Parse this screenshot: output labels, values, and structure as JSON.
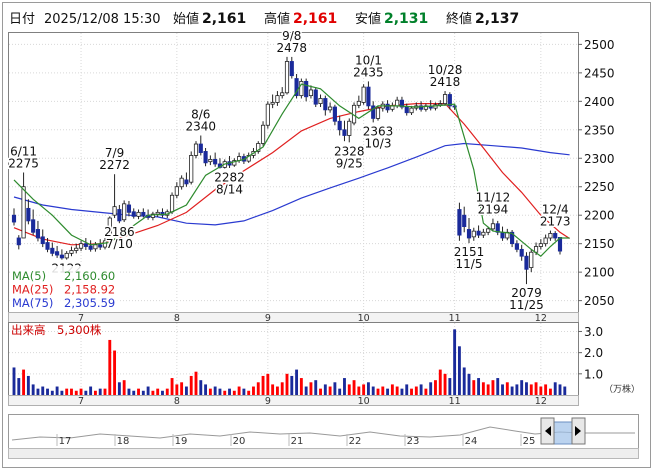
{
  "header": {
    "date_label": "日付",
    "datetime": "2025/12/08 15:30",
    "open_label": "始値",
    "open": "2,161",
    "high_label": "高値",
    "high": "2,161",
    "low_label": "安値",
    "low": "2,131",
    "close_label": "終値",
    "close": "2,137"
  },
  "colors": {
    "up": "#ff0000",
    "down": "#1a2a9a",
    "ma5": "#2e8b2e",
    "ma25": "#e02020",
    "ma75": "#2a3ad0",
    "volume_up": "#ff0000",
    "volume_down": "#1a2a9a",
    "volume_label": "#cc0000"
  },
  "legend": [
    {
      "label": "MA(5)",
      "value": "2,160.60",
      "color": "#2e8b2e"
    },
    {
      "label": "MA(25)",
      "value": "2,158.92",
      "color": "#e02020"
    },
    {
      "label": "MA(75)",
      "value": "2,305.59",
      "color": "#2a3ad0"
    }
  ],
  "volume_header": {
    "label": "出来高",
    "value": "5,300株"
  },
  "volume_unit": "（万株）",
  "navigator": {
    "labels": [
      "17",
      "18",
      "19",
      "20",
      "21",
      "22",
      "23",
      "24",
      "25"
    ],
    "prev_icon": "arrow-left-icon",
    "next_icon": "arrow-right-icon"
  },
  "chart_data": {
    "type": "candlestick",
    "y_range": [
      2030,
      2520
    ],
    "y_ticks": [
      2050,
      2100,
      2150,
      2200,
      2250,
      2300,
      2350,
      2400,
      2450,
      2500
    ],
    "volume_range": [
      0,
      3.4
    ],
    "volume_ticks": [
      "1.0",
      "2.0",
      "3.0"
    ],
    "month_labels": [
      {
        "label": "7",
        "day": 14
      },
      {
        "label": "8",
        "day": 34
      },
      {
        "label": "9",
        "day": 53
      },
      {
        "label": "10",
        "day": 73
      },
      {
        "label": "11",
        "day": 92
      },
      {
        "label": "12",
        "day": 110
      }
    ],
    "annotations": [
      {
        "lines": [
          "6/11",
          "2275"
        ],
        "day": 2,
        "value": 2275,
        "position": "above"
      },
      {
        "lines": [
          "7/9",
          "2272"
        ],
        "day": 21,
        "value": 2272,
        "position": "above"
      },
      {
        "lines": [
          "2186",
          "7/10"
        ],
        "day": 22,
        "value": 2186,
        "position": "below"
      },
      {
        "lines": [
          "2122"
        ],
        "day": 11,
        "value": 2122,
        "position": "below"
      },
      {
        "lines": [
          "8/6",
          "2340"
        ],
        "day": 39,
        "value": 2340,
        "position": "above"
      },
      {
        "lines": [
          "2282",
          "8/14"
        ],
        "day": 45,
        "value": 2282,
        "position": "below"
      },
      {
        "lines": [
          "9/8",
          "2478"
        ],
        "day": 58,
        "value": 2478,
        "position": "above"
      },
      {
        "lines": [
          "2328",
          "9/25"
        ],
        "day": 70,
        "value": 2328,
        "position": "below"
      },
      {
        "lines": [
          "10/1",
          "2435"
        ],
        "day": 74,
        "value": 2435,
        "position": "above"
      },
      {
        "lines": [
          "2363",
          "10/3"
        ],
        "day": 76,
        "value": 2363,
        "position": "below"
      },
      {
        "lines": [
          "10/28",
          "2418"
        ],
        "day": 90,
        "value": 2418,
        "position": "above"
      },
      {
        "lines": [
          "2151",
          "11/5"
        ],
        "day": 95,
        "value": 2151,
        "position": "below"
      },
      {
        "lines": [
          "11/12",
          "2194"
        ],
        "day": 100,
        "value": 2194,
        "position": "above"
      },
      {
        "lines": [
          "2079",
          "11/25"
        ],
        "day": 107,
        "value": 2079,
        "position": "below"
      },
      {
        "lines": [
          "12/4",
          "2173"
        ],
        "day": 113,
        "value": 2173,
        "position": "above"
      }
    ],
    "candles": [
      {
        "o": 2200,
        "h": 2212,
        "c": 2188,
        "l": 2182
      },
      {
        "o": 2160,
        "h": 2165,
        "c": 2148,
        "l": 2140
      },
      {
        "o": 2160,
        "h": 2275,
        "c": 2250,
        "l": 2160
      },
      {
        "o": 2212,
        "h": 2228,
        "c": 2190,
        "l": 2184
      },
      {
        "o": 2192,
        "h": 2210,
        "c": 2170,
        "l": 2165
      },
      {
        "o": 2175,
        "h": 2190,
        "c": 2160,
        "l": 2154
      },
      {
        "o": 2162,
        "h": 2175,
        "c": 2150,
        "l": 2144
      },
      {
        "o": 2152,
        "h": 2160,
        "c": 2140,
        "l": 2135
      },
      {
        "o": 2142,
        "h": 2152,
        "c": 2133,
        "l": 2128
      },
      {
        "o": 2136,
        "h": 2146,
        "c": 2130,
        "l": 2125
      },
      {
        "o": 2130,
        "h": 2140,
        "c": 2125,
        "l": 2122
      },
      {
        "o": 2125,
        "h": 2137,
        "c": 2133,
        "l": 2122
      },
      {
        "o": 2133,
        "h": 2145,
        "c": 2138,
        "l": 2128
      },
      {
        "o": 2138,
        "h": 2150,
        "c": 2142,
        "l": 2133
      },
      {
        "o": 2142,
        "h": 2155,
        "c": 2150,
        "l": 2137
      },
      {
        "o": 2150,
        "h": 2160,
        "c": 2145,
        "l": 2139
      },
      {
        "o": 2146,
        "h": 2156,
        "c": 2140,
        "l": 2136
      },
      {
        "o": 2141,
        "h": 2153,
        "c": 2148,
        "l": 2136
      },
      {
        "o": 2148,
        "h": 2158,
        "c": 2144,
        "l": 2139
      },
      {
        "o": 2144,
        "h": 2160,
        "c": 2155,
        "l": 2140
      },
      {
        "o": 2155,
        "h": 2198,
        "c": 2195,
        "l": 2150
      },
      {
        "o": 2200,
        "h": 2272,
        "c": 2215,
        "l": 2195
      },
      {
        "o": 2210,
        "h": 2218,
        "c": 2190,
        "l": 2186
      },
      {
        "o": 2192,
        "h": 2226,
        "c": 2220,
        "l": 2188
      },
      {
        "o": 2218,
        "h": 2225,
        "c": 2205,
        "l": 2198
      },
      {
        "o": 2206,
        "h": 2212,
        "c": 2198,
        "l": 2194
      },
      {
        "o": 2198,
        "h": 2210,
        "c": 2205,
        "l": 2193
      },
      {
        "o": 2205,
        "h": 2212,
        "c": 2200,
        "l": 2196
      },
      {
        "o": 2200,
        "h": 2210,
        "c": 2196,
        "l": 2192
      },
      {
        "o": 2196,
        "h": 2206,
        "c": 2202,
        "l": 2191
      },
      {
        "o": 2202,
        "h": 2210,
        "c": 2205,
        "l": 2197
      },
      {
        "o": 2205,
        "h": 2212,
        "c": 2200,
        "l": 2196
      },
      {
        "o": 2200,
        "h": 2210,
        "c": 2206,
        "l": 2195
      },
      {
        "o": 2206,
        "h": 2240,
        "c": 2235,
        "l": 2202
      },
      {
        "o": 2235,
        "h": 2258,
        "c": 2250,
        "l": 2230
      },
      {
        "o": 2250,
        "h": 2270,
        "c": 2265,
        "l": 2245
      },
      {
        "o": 2262,
        "h": 2275,
        "c": 2255,
        "l": 2250
      },
      {
        "o": 2258,
        "h": 2312,
        "c": 2305,
        "l": 2254
      },
      {
        "o": 2305,
        "h": 2330,
        "c": 2325,
        "l": 2300
      },
      {
        "o": 2325,
        "h": 2340,
        "c": 2310,
        "l": 2305
      },
      {
        "o": 2312,
        "h": 2318,
        "c": 2292,
        "l": 2286
      },
      {
        "o": 2294,
        "h": 2305,
        "c": 2298,
        "l": 2288
      },
      {
        "o": 2298,
        "h": 2310,
        "c": 2290,
        "l": 2285
      },
      {
        "o": 2290,
        "h": 2300,
        "c": 2284,
        "l": 2282
      },
      {
        "o": 2284,
        "h": 2298,
        "c": 2294,
        "l": 2282
      },
      {
        "o": 2294,
        "h": 2304,
        "c": 2288,
        "l": 2283
      },
      {
        "o": 2288,
        "h": 2300,
        "c": 2296,
        "l": 2285
      },
      {
        "o": 2296,
        "h": 2310,
        "c": 2303,
        "l": 2292
      },
      {
        "o": 2303,
        "h": 2308,
        "c": 2295,
        "l": 2290
      },
      {
        "o": 2295,
        "h": 2310,
        "c": 2305,
        "l": 2292
      },
      {
        "o": 2305,
        "h": 2318,
        "c": 2312,
        "l": 2300
      },
      {
        "o": 2312,
        "h": 2330,
        "c": 2326,
        "l": 2308
      },
      {
        "o": 2326,
        "h": 2365,
        "c": 2358,
        "l": 2322
      },
      {
        "o": 2358,
        "h": 2400,
        "c": 2395,
        "l": 2352
      },
      {
        "o": 2395,
        "h": 2412,
        "c": 2398,
        "l": 2388
      },
      {
        "o": 2398,
        "h": 2418,
        "c": 2410,
        "l": 2392
      },
      {
        "o": 2410,
        "h": 2425,
        "c": 2415,
        "l": 2405
      },
      {
        "o": 2415,
        "h": 2478,
        "c": 2470,
        "l": 2412
      },
      {
        "o": 2470,
        "h": 2478,
        "c": 2445,
        "l": 2440
      },
      {
        "o": 2440,
        "h": 2448,
        "c": 2410,
        "l": 2405
      },
      {
        "o": 2410,
        "h": 2440,
        "c": 2435,
        "l": 2405
      },
      {
        "o": 2435,
        "h": 2440,
        "c": 2408,
        "l": 2400
      },
      {
        "o": 2410,
        "h": 2428,
        "c": 2420,
        "l": 2405
      },
      {
        "o": 2420,
        "h": 2425,
        "c": 2395,
        "l": 2390
      },
      {
        "o": 2396,
        "h": 2412,
        "c": 2405,
        "l": 2390
      },
      {
        "o": 2405,
        "h": 2410,
        "c": 2385,
        "l": 2375
      },
      {
        "o": 2385,
        "h": 2398,
        "c": 2390,
        "l": 2380
      },
      {
        "o": 2390,
        "h": 2394,
        "c": 2365,
        "l": 2358
      },
      {
        "o": 2365,
        "h": 2375,
        "c": 2350,
        "l": 2340
      },
      {
        "o": 2350,
        "h": 2366,
        "c": 2340,
        "l": 2330
      },
      {
        "o": 2340,
        "h": 2370,
        "c": 2365,
        "l": 2328
      },
      {
        "o": 2362,
        "h": 2398,
        "c": 2393,
        "l": 2358
      },
      {
        "o": 2393,
        "h": 2410,
        "c": 2400,
        "l": 2388
      },
      {
        "o": 2398,
        "h": 2430,
        "c": 2425,
        "l": 2394
      },
      {
        "o": 2425,
        "h": 2435,
        "c": 2392,
        "l": 2386
      },
      {
        "o": 2392,
        "h": 2400,
        "c": 2370,
        "l": 2363
      },
      {
        "o": 2370,
        "h": 2392,
        "c": 2388,
        "l": 2366
      },
      {
        "o": 2388,
        "h": 2400,
        "c": 2395,
        "l": 2382
      },
      {
        "o": 2395,
        "h": 2402,
        "c": 2385,
        "l": 2380
      },
      {
        "o": 2386,
        "h": 2398,
        "c": 2392,
        "l": 2382
      },
      {
        "o": 2392,
        "h": 2408,
        "c": 2402,
        "l": 2388
      },
      {
        "o": 2402,
        "h": 2408,
        "c": 2390,
        "l": 2386
      },
      {
        "o": 2390,
        "h": 2396,
        "c": 2380,
        "l": 2375
      },
      {
        "o": 2380,
        "h": 2392,
        "c": 2388,
        "l": 2376
      },
      {
        "o": 2388,
        "h": 2398,
        "c": 2392,
        "l": 2384
      },
      {
        "o": 2392,
        "h": 2400,
        "c": 2386,
        "l": 2382
      },
      {
        "o": 2386,
        "h": 2396,
        "c": 2392,
        "l": 2382
      },
      {
        "o": 2392,
        "h": 2402,
        "c": 2388,
        "l": 2384
      },
      {
        "o": 2388,
        "h": 2398,
        "c": 2394,
        "l": 2384
      },
      {
        "o": 2394,
        "h": 2402,
        "c": 2396,
        "l": 2390
      },
      {
        "o": 2396,
        "h": 2418,
        "c": 2412,
        "l": 2392
      },
      {
        "o": 2412,
        "h": 2416,
        "c": 2392,
        "l": 2386
      },
      {
        "o": 2392,
        "h": 2396,
        "c": 2390,
        "l": 2385
      },
      {
        "o": 2210,
        "h": 2222,
        "c": 2165,
        "l": 2155
      },
      {
        "o": 2200,
        "h": 2215,
        "c": 2180,
        "l": 2170
      },
      {
        "o": 2175,
        "h": 2195,
        "c": 2160,
        "l": 2151
      },
      {
        "o": 2162,
        "h": 2178,
        "c": 2172,
        "l": 2155
      },
      {
        "o": 2172,
        "h": 2182,
        "c": 2165,
        "l": 2160
      },
      {
        "o": 2165,
        "h": 2176,
        "c": 2170,
        "l": 2160
      },
      {
        "o": 2170,
        "h": 2180,
        "c": 2176,
        "l": 2165
      },
      {
        "o": 2176,
        "h": 2194,
        "c": 2185,
        "l": 2172
      },
      {
        "o": 2185,
        "h": 2190,
        "c": 2170,
        "l": 2165
      },
      {
        "o": 2170,
        "h": 2180,
        "c": 2160,
        "l": 2155
      },
      {
        "o": 2160,
        "h": 2176,
        "c": 2170,
        "l": 2156
      },
      {
        "o": 2170,
        "h": 2174,
        "c": 2150,
        "l": 2144
      },
      {
        "o": 2150,
        "h": 2156,
        "c": 2140,
        "l": 2135
      },
      {
        "o": 2140,
        "h": 2148,
        "c": 2128,
        "l": 2120
      },
      {
        "o": 2128,
        "h": 2135,
        "c": 2105,
        "l": 2079
      },
      {
        "o": 2108,
        "h": 2140,
        "c": 2135,
        "l": 2100
      },
      {
        "o": 2135,
        "h": 2152,
        "c": 2145,
        "l": 2130
      },
      {
        "o": 2145,
        "h": 2158,
        "c": 2150,
        "l": 2140
      },
      {
        "o": 2150,
        "h": 2166,
        "c": 2160,
        "l": 2145
      },
      {
        "o": 2160,
        "h": 2173,
        "c": 2168,
        "l": 2155
      },
      {
        "o": 2168,
        "h": 2172,
        "c": 2160,
        "l": 2155
      },
      {
        "o": 2161,
        "h": 2161,
        "c": 2137,
        "l": 2131
      }
    ],
    "volume": [
      1.3,
      0.8,
      1.2,
      0.9,
      0.5,
      0.3,
      0.4,
      0.3,
      0.2,
      0.4,
      0.2,
      0.3,
      0.3,
      0.2,
      0.3,
      0.2,
      0.4,
      0.2,
      0.3,
      0.3,
      2.6,
      2.1,
      0.6,
      0.7,
      0.3,
      0.2,
      0.3,
      0.2,
      0.4,
      0.2,
      0.3,
      0.2,
      0.3,
      0.8,
      0.5,
      0.6,
      0.4,
      0.9,
      1.1,
      0.7,
      0.5,
      0.3,
      0.4,
      0.3,
      0.2,
      0.3,
      0.2,
      0.4,
      0.3,
      0.2,
      0.4,
      0.6,
      0.9,
      1.0,
      0.5,
      0.4,
      0.6,
      1.0,
      0.9,
      1.2,
      0.8,
      0.4,
      0.6,
      0.7,
      0.3,
      0.5,
      0.4,
      0.6,
      0.3,
      0.8,
      0.5,
      0.7,
      0.4,
      0.5,
      0.6,
      0.4,
      0.3,
      0.4,
      0.3,
      0.5,
      0.4,
      0.3,
      0.5,
      0.3,
      0.4,
      0.5,
      0.3,
      0.6,
      0.7,
      1.2,
      1.0,
      0.8,
      3.1,
      2.3,
      1.3,
      1.0,
      0.7,
      0.8,
      0.6,
      0.5,
      0.7,
      0.8,
      0.5,
      0.6,
      0.4,
      0.5,
      0.7,
      0.6,
      0.5,
      0.6,
      0.4,
      0.5,
      0.3,
      0.6,
      0.5,
      0.4
    ],
    "ma5": [
      [
        0,
        2262
      ],
      [
        4,
        2228
      ],
      [
        8,
        2200
      ],
      [
        12,
        2165
      ],
      [
        16,
        2148
      ],
      [
        20,
        2152
      ],
      [
        24,
        2176
      ],
      [
        28,
        2200
      ],
      [
        32,
        2202
      ],
      [
        36,
        2218
      ],
      [
        40,
        2270
      ],
      [
        44,
        2290
      ],
      [
        48,
        2298
      ],
      [
        52,
        2320
      ],
      [
        56,
        2378
      ],
      [
        60,
        2430
      ],
      [
        64,
        2422
      ],
      [
        68,
        2392
      ],
      [
        72,
        2370
      ],
      [
        76,
        2392
      ],
      [
        80,
        2392
      ],
      [
        84,
        2390
      ],
      [
        88,
        2392
      ],
      [
        92,
        2395
      ],
      [
        96,
        2280
      ],
      [
        98,
        2186
      ],
      [
        100,
        2172
      ],
      [
        104,
        2168
      ],
      [
        108,
        2140
      ],
      [
        110,
        2128
      ],
      [
        112,
        2145
      ],
      [
        114,
        2160
      ],
      [
        116,
        2160
      ]
    ],
    "ma25": [
      [
        0,
        2178
      ],
      [
        6,
        2158
      ],
      [
        12,
        2148
      ],
      [
        18,
        2150
      ],
      [
        24,
        2165
      ],
      [
        30,
        2182
      ],
      [
        36,
        2205
      ],
      [
        42,
        2245
      ],
      [
        48,
        2278
      ],
      [
        54,
        2310
      ],
      [
        60,
        2348
      ],
      [
        66,
        2370
      ],
      [
        72,
        2382
      ],
      [
        78,
        2392
      ],
      [
        84,
        2396
      ],
      [
        90,
        2396
      ],
      [
        94,
        2360
      ],
      [
        98,
        2318
      ],
      [
        102,
        2275
      ],
      [
        106,
        2240
      ],
      [
        110,
        2200
      ],
      [
        114,
        2170
      ],
      [
        116,
        2159
      ]
    ],
    "ma75": [
      [
        0,
        2232
      ],
      [
        6,
        2218
      ],
      [
        12,
        2210
      ],
      [
        18,
        2205
      ],
      [
        24,
        2200
      ],
      [
        30,
        2197
      ],
      [
        36,
        2186
      ],
      [
        42,
        2183
      ],
      [
        48,
        2190
      ],
      [
        54,
        2208
      ],
      [
        60,
        2230
      ],
      [
        66,
        2248
      ],
      [
        72,
        2265
      ],
      [
        78,
        2283
      ],
      [
        84,
        2302
      ],
      [
        90,
        2322
      ],
      [
        94,
        2326
      ],
      [
        100,
        2322
      ],
      [
        106,
        2318
      ],
      [
        112,
        2310
      ],
      [
        116,
        2306
      ]
    ]
  }
}
